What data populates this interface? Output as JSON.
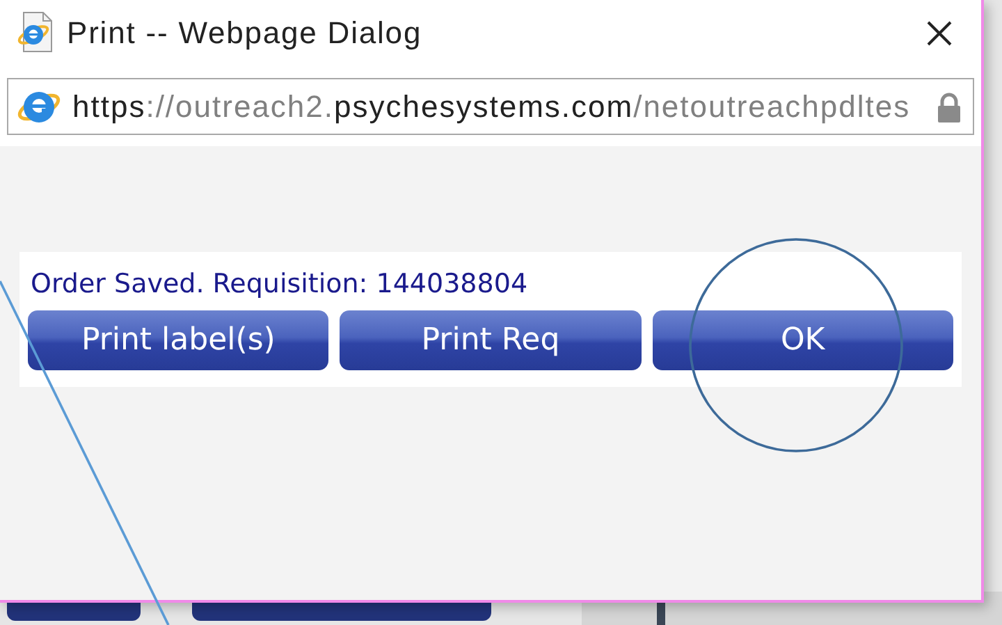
{
  "window": {
    "title": "Print -- Webpage Dialog"
  },
  "address_bar": {
    "url_parts": [
      {
        "text": "https",
        "dim": false
      },
      {
        "text": "://outreach2.",
        "dim": true
      },
      {
        "text": "psychesystems.com",
        "dim": false
      },
      {
        "text": "/netoutreachpdltes",
        "dim": true
      }
    ]
  },
  "message": "Order Saved. Requisition: 144038804",
  "buttons": [
    "Print label(s)",
    "Print Req",
    "OK"
  ]
}
